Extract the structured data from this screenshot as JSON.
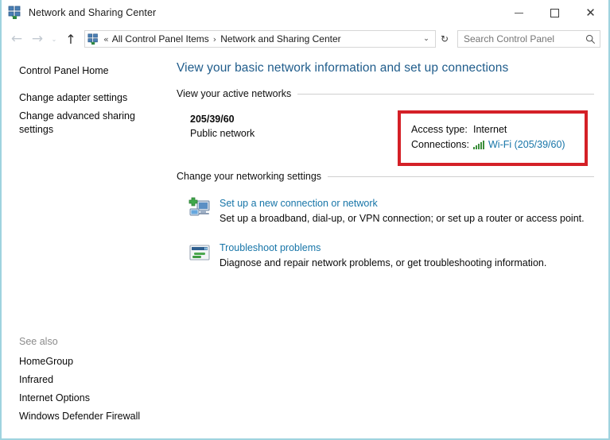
{
  "window": {
    "title": "Network and Sharing Center",
    "app_icon": "network-sharing-icon",
    "minimize_label": "Minimize",
    "maximize_label": "Maximize",
    "close_label": "Close"
  },
  "navbar": {
    "back_label": "←",
    "forward_label": "→",
    "recent_label": "⌄",
    "up_label": "↑",
    "breadcrumb": {
      "icon": "network-sharing-icon",
      "separator_double": "«",
      "separator": "›",
      "items": [
        {
          "label": "All Control Panel Items"
        },
        {
          "label": "Network and Sharing Center"
        }
      ],
      "chevron": "⌄"
    },
    "refresh_label": "↻",
    "search": {
      "placeholder": "Search Control Panel",
      "value": "",
      "icon": "search-icon"
    }
  },
  "sidebar": {
    "items": [
      {
        "label": "Control Panel Home"
      },
      {
        "label": "Change adapter settings"
      },
      {
        "label": "Change advanced sharing settings"
      }
    ],
    "see_also": {
      "title": "See also",
      "items": [
        {
          "label": "HomeGroup"
        },
        {
          "label": "Infrared"
        },
        {
          "label": "Internet Options"
        },
        {
          "label": "Windows Defender Firewall"
        }
      ]
    }
  },
  "main": {
    "page_title": "View your basic network information and set up connections",
    "active_networks": {
      "section_label": "View your active networks",
      "network_name": "205/39/60",
      "network_type": "Public network",
      "details": {
        "highlight_color": "#d42027",
        "access_type_key": "Access type:",
        "access_type_value": "Internet",
        "connections_key": "Connections:",
        "connections_icon": "wifi-signal-icon",
        "connections_value": "Wi-Fi (205/39/60)"
      }
    },
    "networking_settings": {
      "section_label": "Change your networking settings",
      "items": [
        {
          "icon": "new-connection-icon",
          "title": "Set up a new connection or network",
          "description": "Set up a broadband, dial-up, or VPN connection; or set up a router or access point."
        },
        {
          "icon": "troubleshoot-icon",
          "title": "Troubleshoot problems",
          "description": "Diagnose and repair network problems, or get troubleshooting information."
        }
      ]
    }
  },
  "colors": {
    "accent_link": "#1775a8",
    "title_blue": "#1f5c8b",
    "highlight_red": "#d42027",
    "signal_green": "#3c8f3c",
    "window_border": "#9fd3df"
  }
}
